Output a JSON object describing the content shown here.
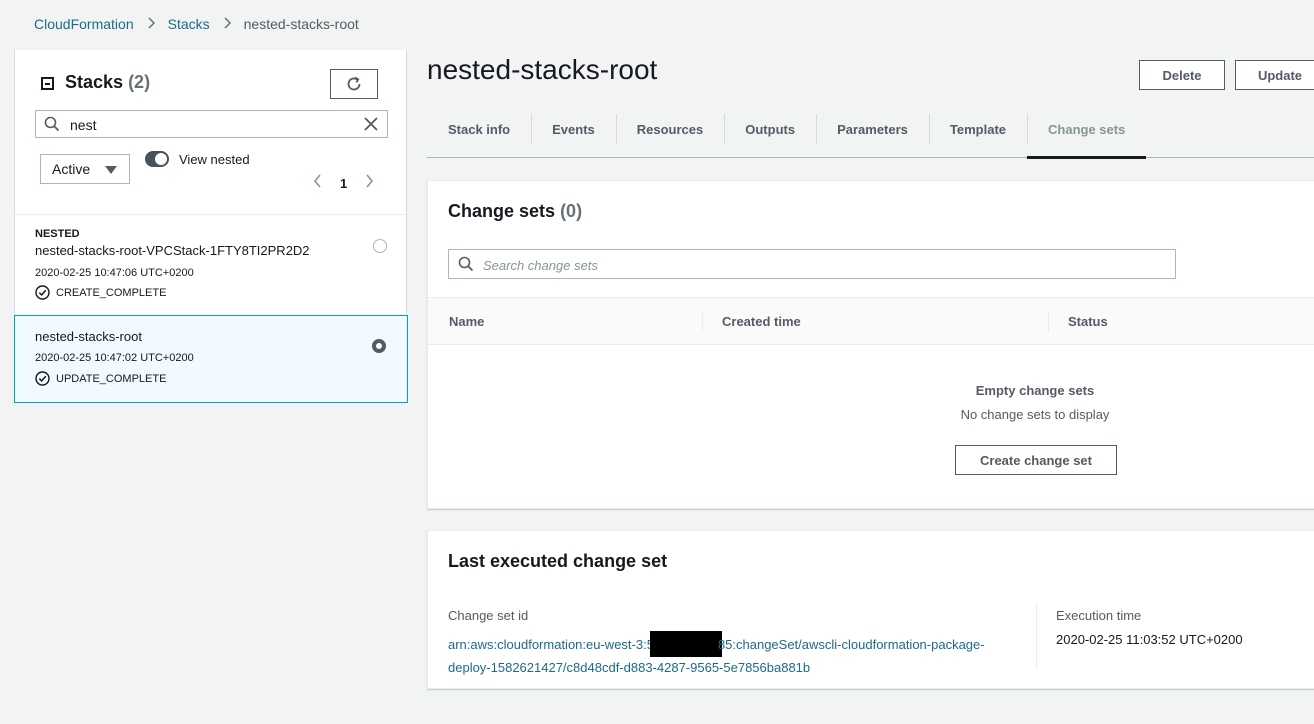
{
  "breadcrumb": {
    "items": [
      "CloudFormation",
      "Stacks"
    ],
    "current": "nested-stacks-root"
  },
  "stacks_panel": {
    "title": "Stacks",
    "count": "(2)",
    "search_value": "nest",
    "filter_value": "Active",
    "toggle_label": "View nested",
    "page": "1",
    "items": [
      {
        "tag": "NESTED",
        "name": "nested-stacks-root-VPCStack-1FTY8TI2PR2D2",
        "time": "2020-02-25 10:47:06 UTC+0200",
        "status": "CREATE_COMPLETE"
      },
      {
        "name": "nested-stacks-root",
        "time": "2020-02-25 10:47:02 UTC+0200",
        "status": "UPDATE_COMPLETE"
      }
    ]
  },
  "header": {
    "title": "nested-stacks-root",
    "delete_label": "Delete",
    "update_label": "Update"
  },
  "tabs": [
    "Stack info",
    "Events",
    "Resources",
    "Outputs",
    "Parameters",
    "Template",
    "Change sets"
  ],
  "change_sets": {
    "title": "Change sets",
    "count": "(0)",
    "search_placeholder": "Search change sets",
    "columns": [
      "Name",
      "Created time",
      "Status"
    ],
    "empty_title": "Empty change sets",
    "empty_sub": "No change sets to display",
    "create_label": "Create change set"
  },
  "last_executed": {
    "title": "Last executed change set",
    "id_label": "Change set id",
    "id_part1": "arn:aws:cloudformation:eu-west-3:5",
    "id_part2": "85:changeSet/awscli-cloudformation-package-deploy-1582621427/c8d48cdf-d883-4287-9565-5e7856ba881b",
    "exec_label": "Execution time",
    "exec_value": "2020-02-25 11:03:52 UTC+0200"
  },
  "colors": {
    "link": "#1d6a8a",
    "selected_border": "#00a1c9",
    "selected_bg": "#f1faff"
  }
}
